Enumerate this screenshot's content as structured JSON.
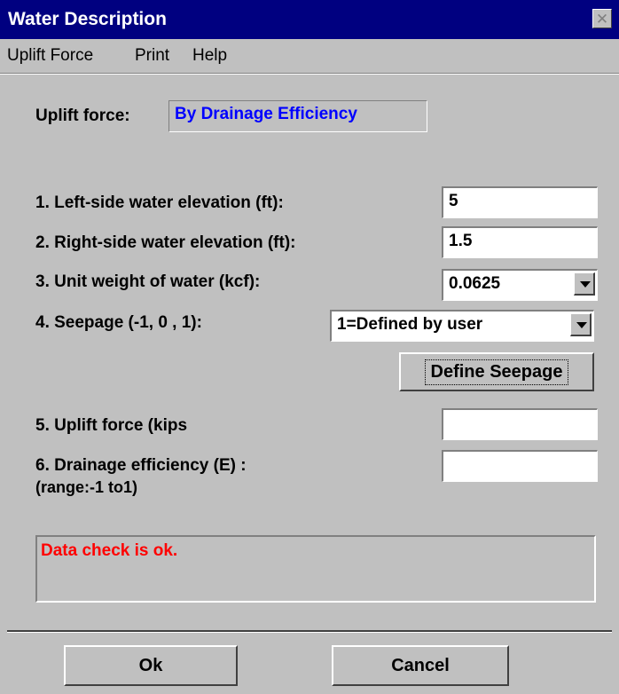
{
  "window": {
    "title": "Water Description",
    "close_glyph": "✕"
  },
  "menu": [
    {
      "label": "Uplift Force"
    },
    {
      "label": "Print"
    },
    {
      "label": "Help"
    }
  ],
  "uplift": {
    "label": "Uplift force:",
    "value": "By Drainage Efficiency"
  },
  "fields": {
    "left_elev": {
      "label": "1. Left-side water elevation (ft):",
      "value": "5"
    },
    "right_elev": {
      "label": "2. Right-side water elevation (ft):",
      "value": "1.5"
    },
    "unit_weight": {
      "label": "3. Unit weight of water (kcf):",
      "value": "0.0625"
    },
    "seepage": {
      "label": "4. Seepage (-1, 0 , 1):",
      "value": "1=Defined by user"
    },
    "uplift_force": {
      "label": "5. Uplift force (kips",
      "value": ""
    },
    "drainage": {
      "label_line1": "6. Drainage efficiency (E) :",
      "label_line2": "(range:-1 to1)",
      "value": ""
    }
  },
  "define_seepage_label": "Define Seepage",
  "status": {
    "message": "Data check is ok.",
    "color": "#ff0000"
  },
  "buttons": {
    "ok": "Ok",
    "cancel": "Cancel"
  },
  "colors": {
    "titlebar": "#000080",
    "uplift_value": "#0000ff",
    "face": "#c0c0c0"
  }
}
